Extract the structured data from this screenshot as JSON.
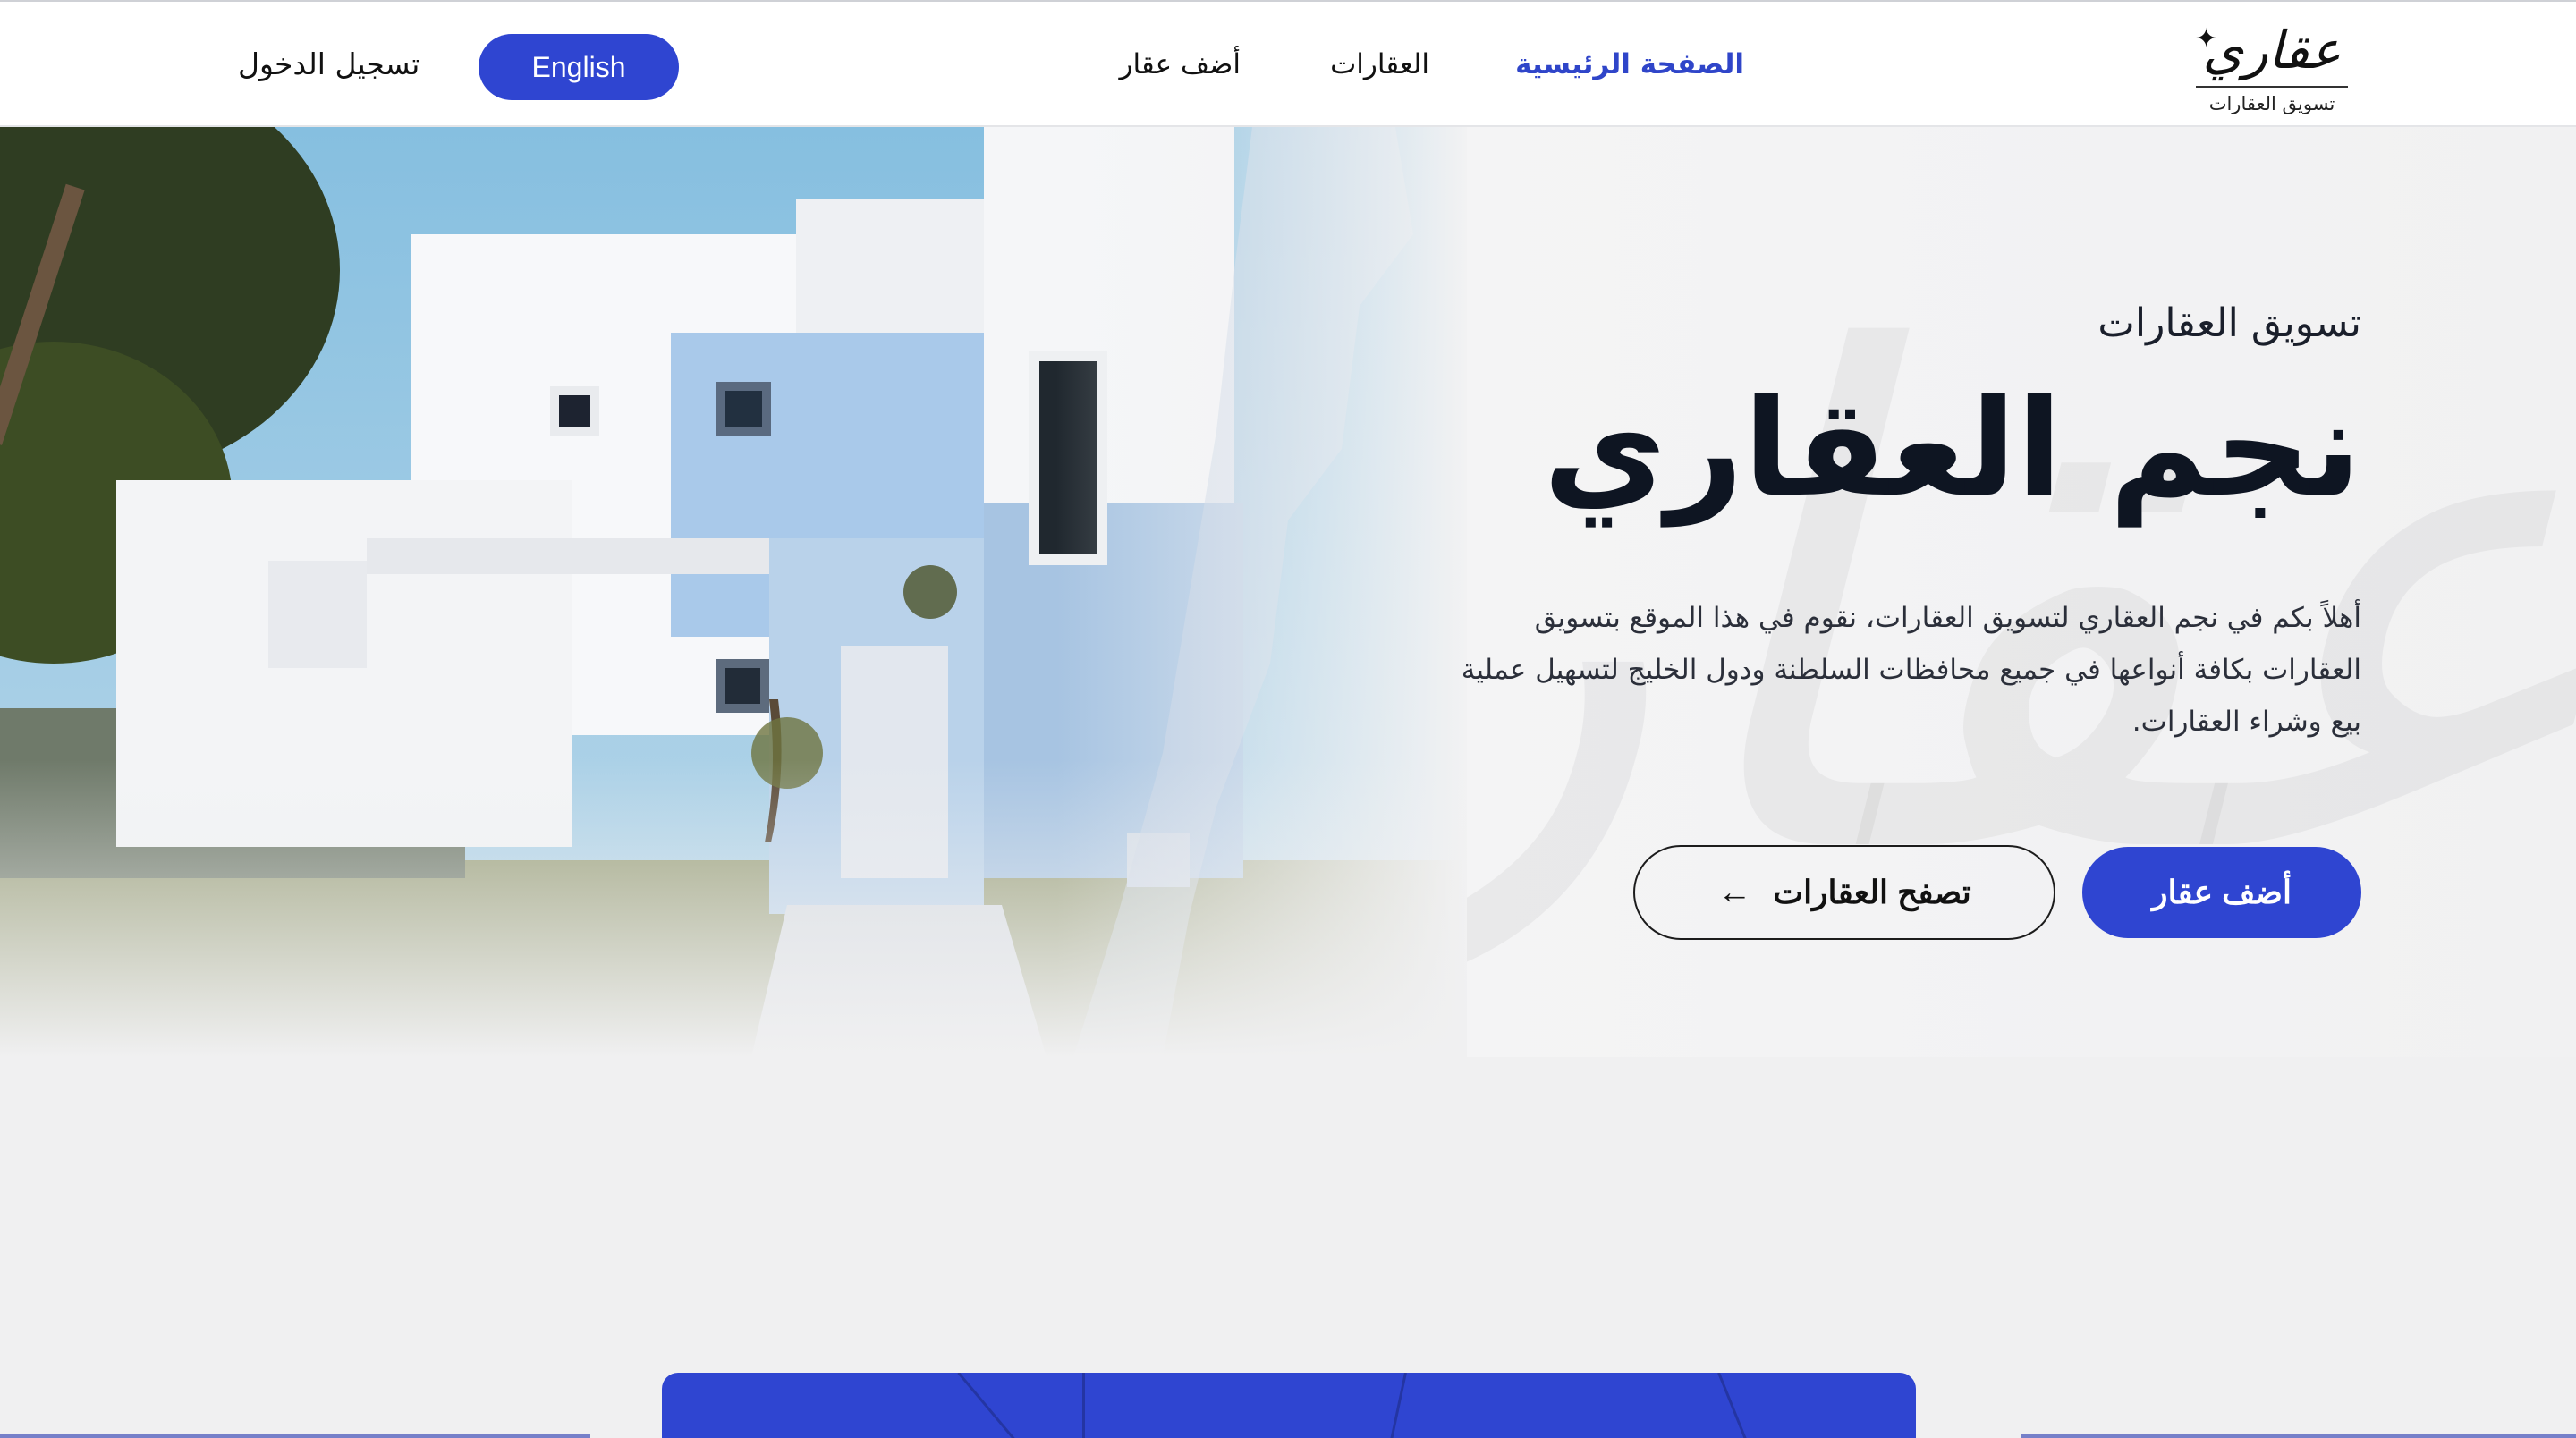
{
  "header": {
    "logo": {
      "mark": "عقاري",
      "star": "✦",
      "subtitle": "تسويق العقارات"
    },
    "nav": {
      "home": "الصفحة الرئيسية",
      "properties": "العقارات",
      "add_property": "أضف عقار"
    },
    "language_button": "English",
    "login_link": "تسجيل الدخول",
    "colors": {
      "accent": "#2f45d1",
      "active_nav": "#2f45c9"
    }
  },
  "hero": {
    "kicker": "تسويق العقارات",
    "title": "نجم العقاري",
    "description": "أهلاً بكم في نجم العقاري لتسويق العقارات، نقوم في هذا الموقع بتسويق العقارات بكافة أنواعها في جميع محافظات السلطنة ودول الخليج لتسهيل عملية بيع وشراء العقارات.",
    "primary_button": "أضف عقار",
    "secondary_button": "تصفح العقارات",
    "secondary_button_icon": "arrow-left-icon",
    "background_calligraphy": "عقاري"
  }
}
